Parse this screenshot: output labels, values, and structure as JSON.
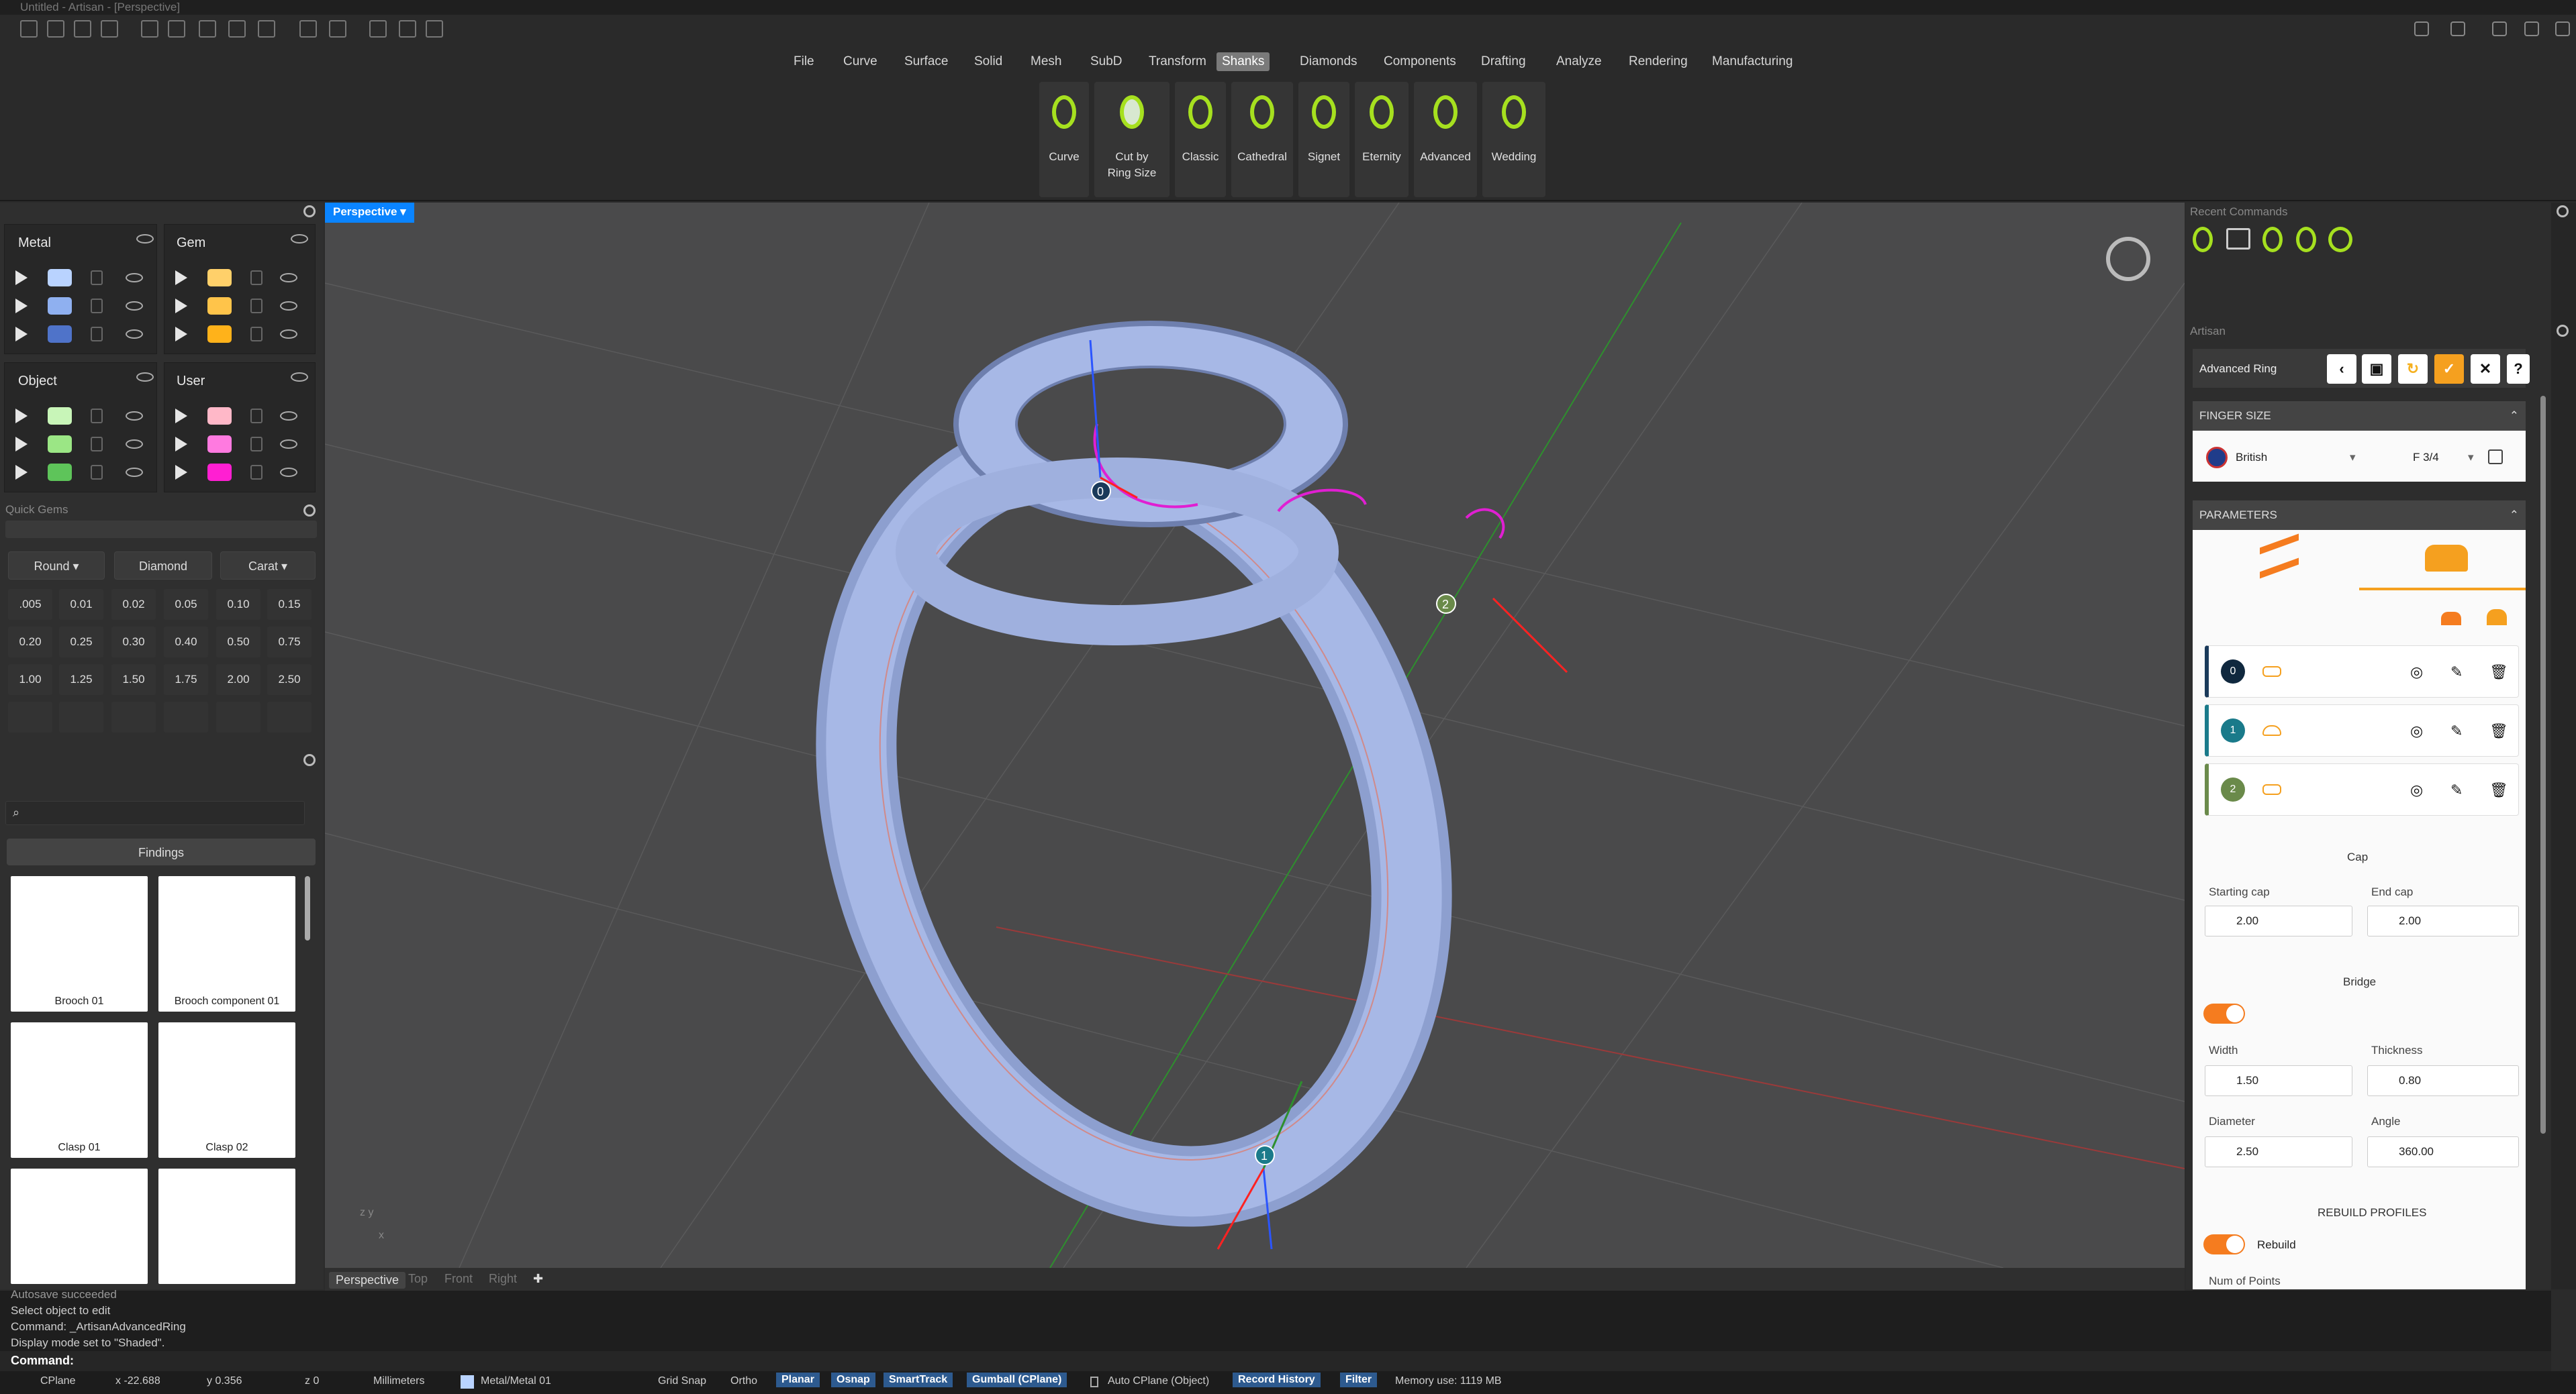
{
  "window": {
    "title": "Untitled - Artisan - [Perspective]"
  },
  "menu": {
    "items": [
      "File",
      "Curve",
      "Surface",
      "Solid",
      "Mesh",
      "SubD",
      "Transform",
      "Shanks",
      "Diamonds",
      "Components",
      "Drafting",
      "Analyze",
      "Rendering",
      "Manufacturing"
    ],
    "active": "Shanks"
  },
  "tools": [
    {
      "label": "Curve"
    },
    {
      "label": "Cut by Ring Size"
    },
    {
      "label": "Classic"
    },
    {
      "label": "Cathedral"
    },
    {
      "label": "Signet"
    },
    {
      "label": "Eternity"
    },
    {
      "label": "Advanced"
    },
    {
      "label": "Wedding"
    }
  ],
  "colors": {
    "accent": "#f57c1f",
    "tool_icon": "#a6e01f",
    "viewport_active": "#0a84ff",
    "model": "#a7b8e6",
    "teal": "#1a7a8a"
  },
  "layers": {
    "metal": {
      "title": "Metal",
      "swatches": [
        "#b9d3ff",
        "#8fb0f0",
        "#4f73c9"
      ]
    },
    "gem": {
      "title": "Gem",
      "swatches": [
        "#ffd06a",
        "#ffc44a",
        "#ffb21a"
      ]
    },
    "object": {
      "title": "Object",
      "swatches": [
        "#c8f5b8",
        "#9be685",
        "#5ec45a"
      ]
    },
    "user": {
      "title": "User",
      "swatches": [
        "#ffb8c8",
        "#ff7ae0",
        "#ff1fd2"
      ]
    }
  },
  "quick_gems": {
    "title": "Quick Gems",
    "shape": "Round",
    "material": "Diamond",
    "unit": "Carat",
    "values": [
      ".005",
      "0.01",
      "0.02",
      "0.05",
      "0.10",
      "0.15",
      "0.20",
      "0.25",
      "0.30",
      "0.40",
      "0.50",
      "0.75",
      "1.00",
      "1.25",
      "1.50",
      "1.75",
      "2.00",
      "2.50"
    ]
  },
  "library": {
    "category": "Findings",
    "items": [
      {
        "name": "Brooch 01"
      },
      {
        "name": "Brooch component 01"
      },
      {
        "name": "Clasp 01"
      },
      {
        "name": "Clasp 02"
      },
      {
        "name": ""
      },
      {
        "name": ""
      }
    ]
  },
  "viewport": {
    "name": "Perspective",
    "tabs": [
      "Perspective",
      "Top",
      "Front",
      "Right"
    ],
    "point_labels": [
      "0",
      "1",
      "2"
    ]
  },
  "right": {
    "recent_title": "Recent Commands",
    "artisan_title": "Artisan",
    "tool_name": "Advanced Ring",
    "finger_size": {
      "title": "FINGER SIZE",
      "standard": "British",
      "size": "F 3/4"
    },
    "parameters": {
      "title": "PARAMETERS",
      "profiles": [
        "0",
        "1",
        "2"
      ]
    },
    "cap": {
      "title": "Cap",
      "starting_label": "Starting cap",
      "starting_value": "2.00",
      "end_label": "End cap",
      "end_value": "2.00"
    },
    "bridge": {
      "title": "Bridge",
      "width_label": "Width",
      "width": "1.50",
      "thickness_label": "Thickness",
      "thickness": "0.80",
      "diameter_label": "Diameter",
      "diameter": "2.50",
      "angle_label": "Angle",
      "angle": "360.00"
    },
    "rebuild": {
      "title": "REBUILD PROFILES",
      "toggle_label": "Rebuild",
      "num_points_label": "Num of Points"
    }
  },
  "history": [
    "Autosave succeeded",
    "Select object to edit",
    "Command: _ArtisanAdvancedRing",
    "Display mode set to \"Shaded\"."
  ],
  "command_prompt": "Command:",
  "status": {
    "cplane": "CPlane",
    "x": "x -22.688",
    "y": "y 0.356",
    "z": "z 0",
    "units": "Millimeters",
    "layer": "Metal/Metal 01",
    "grid_snap": "Grid Snap",
    "ortho": "Ortho",
    "planar": "Planar",
    "osnap": "Osnap",
    "smarttrack": "SmartTrack",
    "gumball": "Gumball (CPlane)",
    "auto_cplane": "Auto CPlane (Object)",
    "record_history": "Record History",
    "filter": "Filter",
    "memory": "Memory use: 1119 MB"
  }
}
